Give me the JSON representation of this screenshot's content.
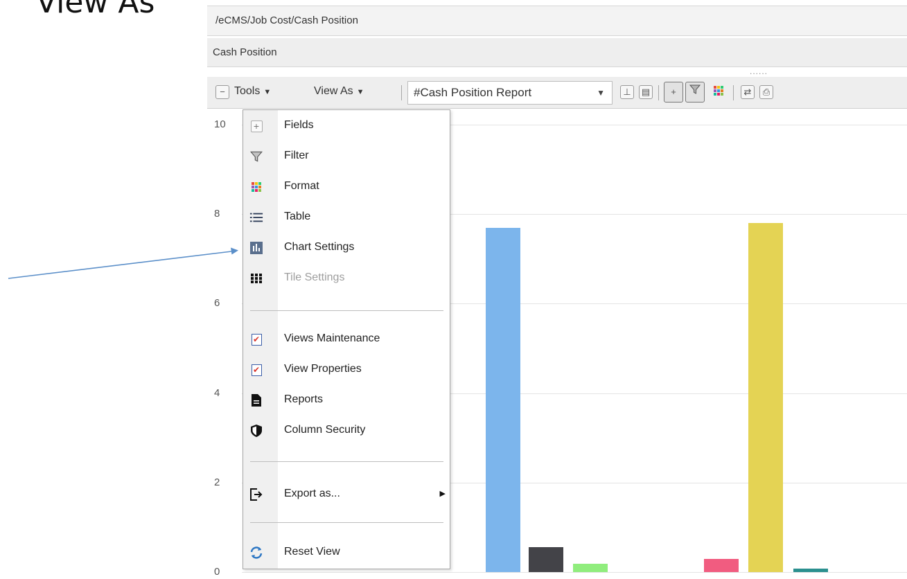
{
  "slide": {
    "title": "View As"
  },
  "breadcrumb": {
    "path": "/eCMS/Job Cost/Cash Position"
  },
  "window": {
    "title": "Cash Position"
  },
  "toolbar": {
    "collapse_icon": "minus-icon",
    "tools_label": "Tools",
    "view_as_label": "View As",
    "view_select_value": "#Cash Position Report",
    "icons": [
      "pin-icon",
      "save-icon",
      "add-field-icon",
      "filter-icon",
      "format-icon",
      "refresh-icon",
      "print-icon"
    ]
  },
  "menu": {
    "items": [
      {
        "label": "Fields",
        "icon": "plus-icon",
        "enabled": true
      },
      {
        "label": "Filter",
        "icon": "funnel-icon",
        "enabled": true
      },
      {
        "label": "Format",
        "icon": "color-grid-icon",
        "enabled": true
      },
      {
        "label": "Table",
        "icon": "list-icon",
        "enabled": true
      },
      {
        "label": "Chart Settings",
        "icon": "bar-chart-icon",
        "enabled": true
      },
      {
        "label": "Tile Settings",
        "icon": "tile-grid-icon",
        "enabled": false
      },
      {
        "label": "Views Maintenance",
        "icon": "checklist-icon",
        "enabled": true
      },
      {
        "label": "View Properties",
        "icon": "checklist-icon",
        "enabled": true
      },
      {
        "label": "Reports",
        "icon": "document-icon",
        "enabled": true
      },
      {
        "label": "Column Security",
        "icon": "shield-icon",
        "enabled": true
      },
      {
        "label": "Export as...",
        "icon": "export-icon",
        "enabled": true,
        "has_submenu": true
      },
      {
        "label": "Reset View",
        "icon": "reset-icon",
        "enabled": true
      }
    ]
  },
  "chart_data": {
    "type": "bar",
    "y_ticks": [
      "10",
      "8",
      "6",
      "4",
      "2",
      "0"
    ],
    "ylim": [
      0,
      10
    ],
    "grid": true,
    "bars": [
      {
        "value": 7.7,
        "color": "#7cb5ec"
      },
      {
        "value": 0.55,
        "color": "#434348"
      },
      {
        "value": 0.18,
        "color": "#90ed7d"
      },
      {
        "value": 0.3,
        "color": "#f15c80"
      },
      {
        "value": 7.8,
        "color": "#e4d354"
      },
      {
        "value": 0.08,
        "color": "#2b908f"
      }
    ]
  },
  "annotation": {
    "type": "arrow",
    "target": "Chart Settings",
    "color": "#5b8fc9"
  }
}
